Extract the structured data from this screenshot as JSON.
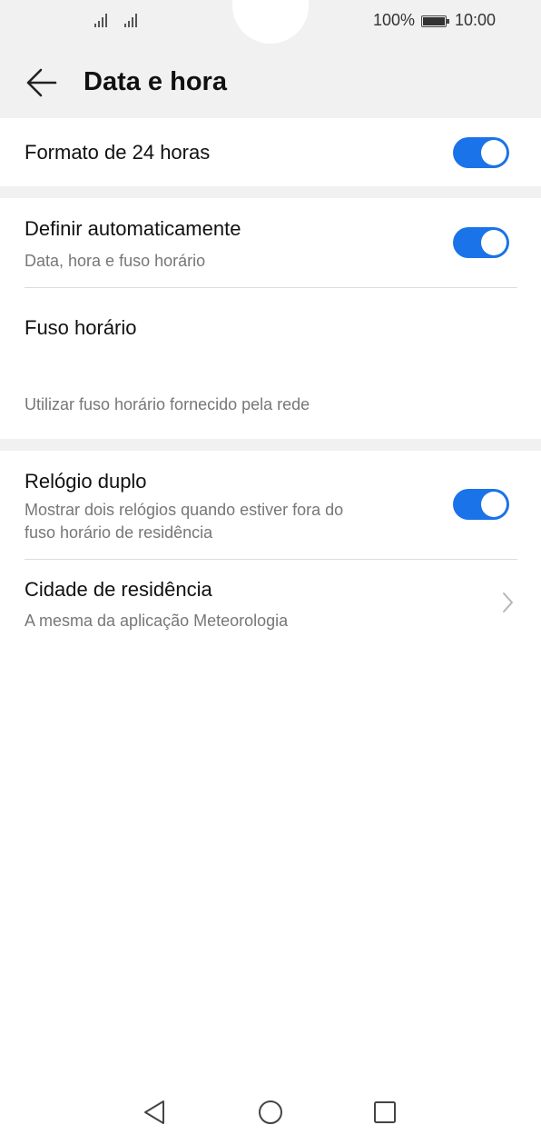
{
  "status_bar": {
    "battery_text": "100%",
    "time": "10:00"
  },
  "header": {
    "title": "Data e hora"
  },
  "settings": {
    "format24": {
      "label": "Formato de 24 horas",
      "enabled": true
    },
    "auto": {
      "label": "Definir automaticamente",
      "sub": "Data, hora e fuso horário",
      "enabled": true
    },
    "timezone": {
      "label": "Fuso horário",
      "sub": "Utilizar fuso horário fornecido pela rede"
    },
    "dual_clock": {
      "label": "Relógio duplo",
      "sub_line1": "Mostrar dois relógios quando estiver fora do",
      "sub_line2": "fuso horário de residência",
      "enabled": true
    },
    "home_city": {
      "label": "Cidade de residência",
      "sub": "A mesma da aplicação Meteorologia"
    }
  },
  "colors": {
    "accent": "#1a73e8",
    "header_bg": "#f1f1f1"
  },
  "icons": [
    "signal-icon",
    "battery-icon",
    "back-arrow-icon",
    "chevron-right-icon",
    "nav-back-icon",
    "nav-home-icon",
    "nav-recents-icon"
  ]
}
